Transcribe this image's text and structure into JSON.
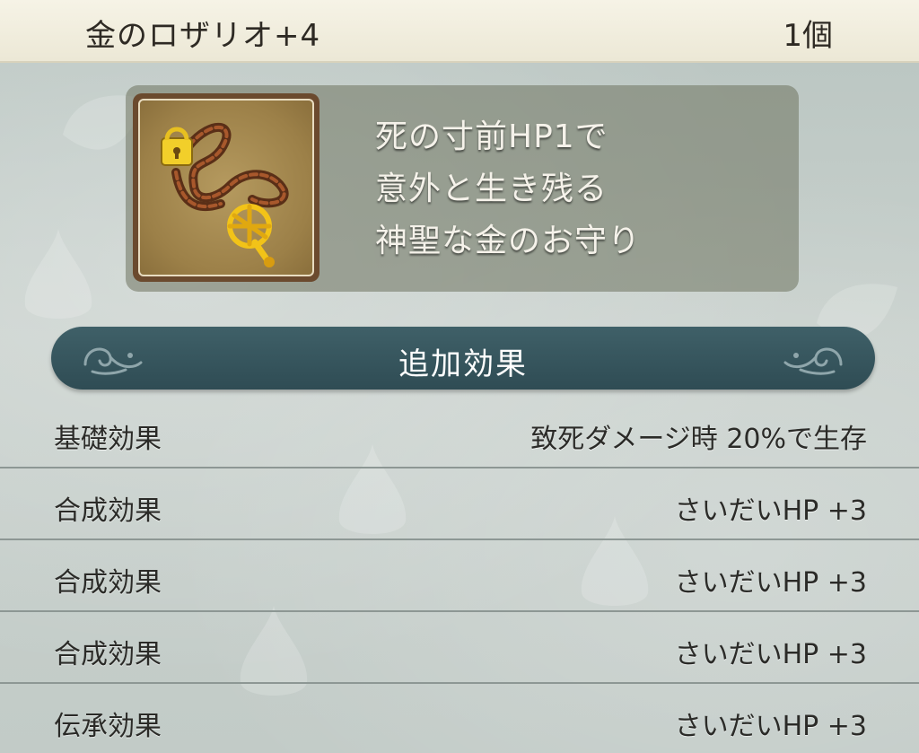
{
  "header": {
    "item_name": "金のロザリオ+4",
    "count": "1個"
  },
  "item": {
    "icon": "gold-rosary-icon",
    "description": [
      "死の寸前HP1で",
      "意外と生き残る",
      "神聖な金のお守り"
    ]
  },
  "section": {
    "title": "追加効果"
  },
  "effects": [
    {
      "label": "基礎効果",
      "value": "致死ダメージ時 20%で生存"
    },
    {
      "label": "合成効果",
      "value": "さいだいHP +3"
    },
    {
      "label": "合成効果",
      "value": "さいだいHP +3"
    },
    {
      "label": "合成効果",
      "value": "さいだいHP +3"
    },
    {
      "label": "伝承効果",
      "value": "さいだいHP +3"
    }
  ],
  "colors": {
    "header_bg": "#f2efe0",
    "banner": "#35535b",
    "panel": "#6e735f",
    "text_dark": "#2b2b28"
  }
}
